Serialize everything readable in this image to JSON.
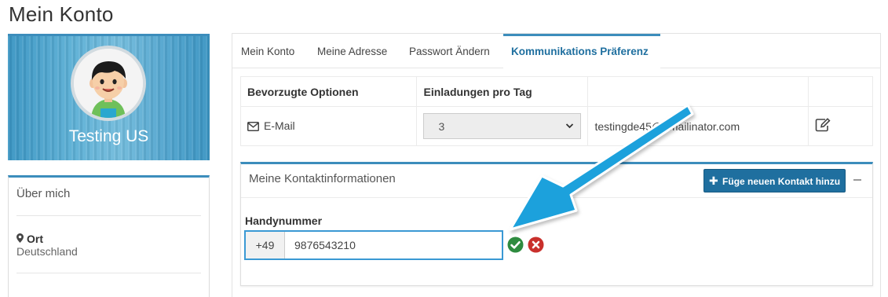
{
  "page": {
    "title": "Mein Konto"
  },
  "profile": {
    "name": "Testing US"
  },
  "about": {
    "title": "Über mich",
    "location_label": "Ort",
    "location_value": "Deutschland"
  },
  "tabs": [
    {
      "label": "Mein Konto",
      "active": false
    },
    {
      "label": "Meine Adresse",
      "active": false
    },
    {
      "label": "Passwort Ändern",
      "active": false
    },
    {
      "label": "Kommunikations Präferenz",
      "active": true
    }
  ],
  "preferences": {
    "headers": [
      "Bevorzugte Optionen",
      "Einladungen pro Tag",
      "",
      ""
    ],
    "rows": [
      {
        "option": "E-Mail",
        "invites_per_day": "3",
        "address": "testingde45@emailinator.com"
      }
    ]
  },
  "contact": {
    "title": "Meine Kontaktinformationen",
    "add_button_label": "Füge neuen Kontakt hinzu",
    "field_label": "Handynummer",
    "country_code": "+49",
    "phone_value": "9876543210"
  },
  "colors": {
    "accent": "#3c8dbc",
    "primary_button": "#1f6f9f",
    "confirm": "#2e8b3f",
    "cancel": "#c9302c",
    "annotation_arrow": "#1da1dc"
  },
  "icons": {
    "mail": "envelope-icon",
    "edit": "edit-icon",
    "location": "map-marker-icon",
    "add": "plus-icon",
    "collapse": "minus-icon",
    "confirm": "check-circle-icon",
    "cancel": "times-circle-icon"
  }
}
